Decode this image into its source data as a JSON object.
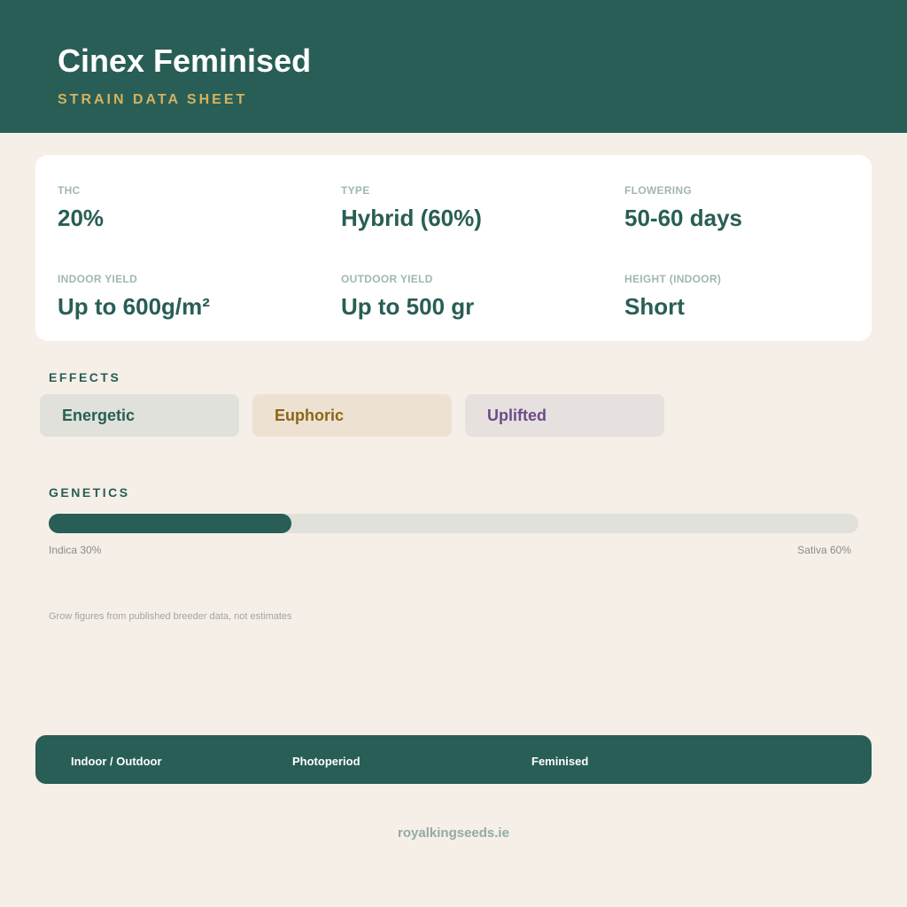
{
  "header": {
    "title": "Cinex Feminised",
    "subtitle": "STRAIN DATA SHEET"
  },
  "stats": [
    {
      "label": "THC",
      "value": "20%"
    },
    {
      "label": "TYPE",
      "value": "Hybrid (60%)"
    },
    {
      "label": "FLOWERING",
      "value": "50-60 days"
    },
    {
      "label": "INDOOR YIELD",
      "value": "Up to 600g/m²"
    },
    {
      "label": "OUTDOOR YIELD",
      "value": "Up to 500 gr"
    },
    {
      "label": "HEIGHT (INDOOR)",
      "value": "Short"
    }
  ],
  "effects": {
    "label": "EFFECTS",
    "items": [
      "Energetic",
      "Euphoric",
      "Uplifted"
    ]
  },
  "genetics": {
    "label": "GENETICS",
    "indica_fraction": 0.3,
    "indica_label": "Indica 30%",
    "sativa_label": "Sativa 60%"
  },
  "note": "Grow figures from published breeder data, not estimates",
  "footer": {
    "items": [
      "Indoor / Outdoor",
      "Photoperiod",
      "Feminised"
    ],
    "site": "royalkingseeds.ie"
  },
  "colors": {
    "brand": "#285e55",
    "accent": "#d6b25e",
    "background": "#f5efe8"
  }
}
